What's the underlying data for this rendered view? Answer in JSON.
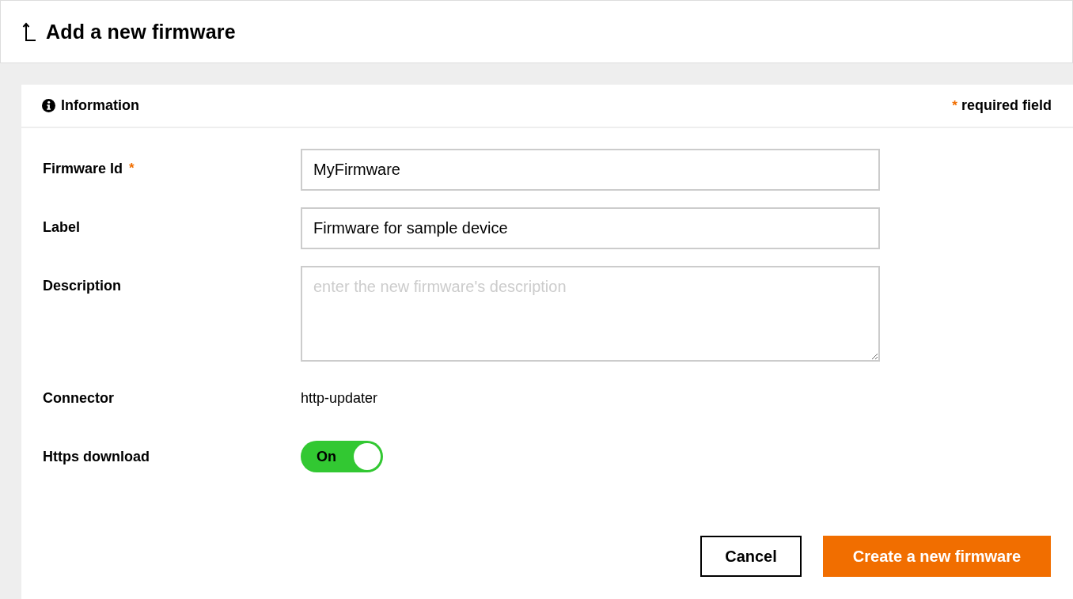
{
  "header": {
    "title": "Add a new firmware"
  },
  "section": {
    "title": "Information",
    "required_note": {
      "mark": "*",
      "text": "required field"
    }
  },
  "fields": [
    {
      "kind": "input",
      "label": "Firmware Id",
      "required_mark": "*",
      "value": "MyFirmware"
    },
    {
      "kind": "input",
      "label": "Label",
      "value": "Firmware for sample device"
    },
    {
      "kind": "textarea",
      "label": "Description",
      "placeholder": "enter the new firmware's description"
    },
    {
      "kind": "text",
      "label": "Connector",
      "value": "http-updater"
    },
    {
      "kind": "toggle",
      "label": "Https download",
      "on": true,
      "text": "On"
    }
  ],
  "buttons": [
    {
      "kind": "secondary",
      "label": "Cancel"
    },
    {
      "kind": "primary",
      "label": "Create a new firmware"
    }
  ]
}
